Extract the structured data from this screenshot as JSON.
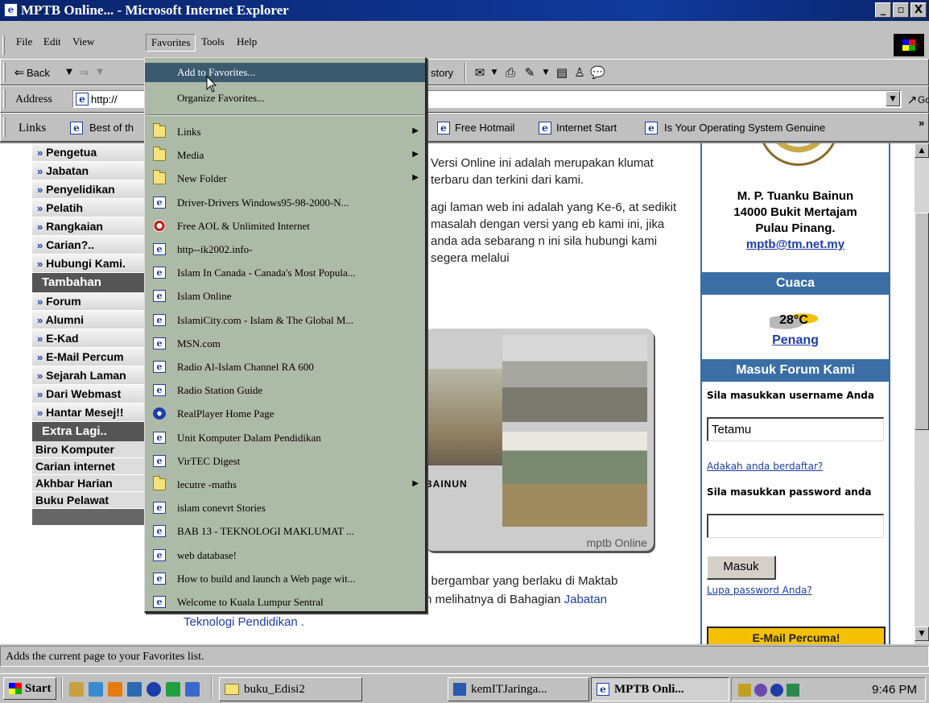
{
  "window": {
    "title": "MPTB Online... - Microsoft Internet Explorer",
    "minimize": "_",
    "maximize": "▫",
    "close": "X"
  },
  "menu": {
    "file": "File",
    "edit": "Edit",
    "view": "View",
    "favorites": "Favorites",
    "tools": "Tools",
    "help": "Help"
  },
  "toolbar": {
    "back": "Back",
    "history": "story"
  },
  "address": {
    "label": "Address",
    "url": "http://",
    "go": "Go"
  },
  "links_bar": {
    "label": "Links",
    "items": [
      "Best of th",
      "Free Hotmail",
      "Internet Start",
      "Is Your Operating System Genuine"
    ]
  },
  "favorites_menu": {
    "add": "Add to Favorites...",
    "organize": "Organize Favorites...",
    "items": [
      {
        "label": "Links",
        "icon": "folder-icon",
        "submenu": true
      },
      {
        "label": "Media",
        "icon": "folder-icon",
        "submenu": true
      },
      {
        "label": "New Folder",
        "icon": "folder-icon",
        "submenu": true
      },
      {
        "label": "Driver-Drivers Windows95-98-2000-N...",
        "icon": "ie-page-icon"
      },
      {
        "label": "Free AOL & Unlimited Internet",
        "icon": "aol-icon"
      },
      {
        "label": "http--ik2002.info-",
        "icon": "ie-page-icon"
      },
      {
        "label": "Islam In Canada - Canada's Most Popula...",
        "icon": "ie-page-icon"
      },
      {
        "label": "Islam Online",
        "icon": "ie-page-icon"
      },
      {
        "label": "IslamiCity.com - Islam & The Global M...",
        "icon": "ie-page-icon"
      },
      {
        "label": "MSN.com",
        "icon": "ie-page-icon"
      },
      {
        "label": "Radio Al-Islam Channel RA 600",
        "icon": "ie-page-icon"
      },
      {
        "label": "Radio Station Guide",
        "icon": "ie-page-icon"
      },
      {
        "label": "RealPlayer Home Page",
        "icon": "realplayer-icon"
      },
      {
        "label": "Unit Komputer Dalam Pendidikan",
        "icon": "ie-page-icon"
      },
      {
        "label": "VirTEC Digest",
        "icon": "ie-page-icon"
      },
      {
        "label": "lecutre -maths",
        "icon": "folder-icon",
        "submenu": true
      },
      {
        "label": "islam conevrt Stories",
        "icon": "ie-page-icon"
      },
      {
        "label": "BAB 13 - TEKNOLOGI MAKLUMAT ...",
        "icon": "ie-page-icon"
      },
      {
        "label": "web database!",
        "icon": "ie-page-icon"
      },
      {
        "label": "How to build and launch a Web page wit...",
        "icon": "ie-page-icon"
      },
      {
        "label": "Welcome to Kuala Lumpur Sentral",
        "icon": "ie-page-icon"
      }
    ]
  },
  "sidebar": {
    "links1": [
      "Pengetua",
      "Jabatan",
      "Penyelidikan",
      "Pelatih",
      "Rangkaian",
      "Carian?..",
      "Hubungi Kami."
    ],
    "head2": "Tambahan",
    "links2": [
      "Forum",
      "Alumni",
      "E-Kad",
      "E-Mail Percum",
      "Sejarah Laman",
      "Dari Webmast",
      "Hantar Mesej!!"
    ],
    "head3": "Extra Lagi..",
    "links3": [
      "Biro Komputer",
      "Carian internet",
      "Akhbar Harian",
      "Buku Pelawat"
    ],
    "bullet": "»"
  },
  "content": {
    "para1": "Versi Online ini adalah merupakan klumat terbaru dan terkini dari kami.",
    "para2": "agi laman web ini adalah yang Ke-6, at sedikit masalah dengan versi yang eb kami ini, jika anda ada sebarang n ini sila hubungi kami segera melalui",
    "photo_bainun": "BAINUN",
    "photo_caption": "mptb Online",
    "bottom_text": "i bergambar yang berlaku di Maktab",
    "bottom_text2": "h melihatnya di Bahagian",
    "bottom_link": "Jabatan",
    "bottom_line": "Teknologi Pendidikan ."
  },
  "right": {
    "addr1": "M. P. Tuanku Bainun",
    "addr2": "14000 Bukit Mertajam",
    "addr3": "Pulau Pinang.",
    "email": "mptb@tm.net.my",
    "cuaca": "Cuaca",
    "temp": "28°C",
    "city": "Penang",
    "forum_head": "Masuk Forum Kami",
    "user_label": "Sila masukkan username Anda",
    "user_value": "Tetamu",
    "registered_link": "Adakah anda berdaftar?",
    "pass_label": "Sila masukkan password anda",
    "submit": "Masuk",
    "forgot_link": "Lupa password Anda?",
    "email_banner": "E-Mail Percuma!"
  },
  "status": {
    "text": "Adds the current page to your Favorites list."
  },
  "taskbar": {
    "start": "Start",
    "tasks": [
      "buku_Edisi2",
      "kemITJaringa...",
      "MPTB Onli..."
    ],
    "clock": "9:46 PM"
  }
}
